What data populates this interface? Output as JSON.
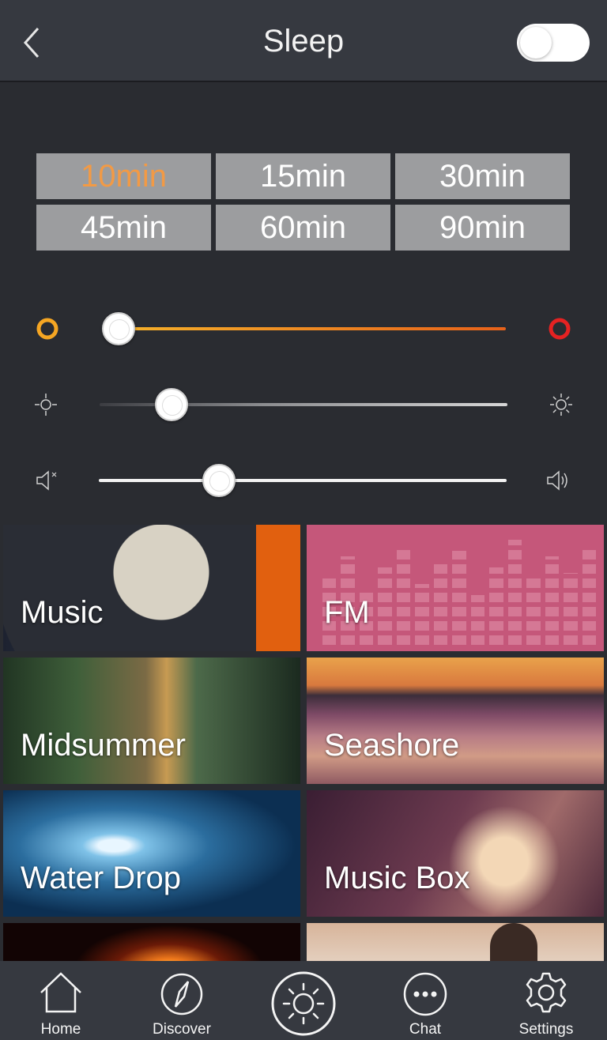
{
  "header": {
    "title": "Sleep",
    "toggle_on": false
  },
  "timer": {
    "options": [
      "10min",
      "15min",
      "30min",
      "45min",
      "60min",
      "90min"
    ],
    "selected": "10min",
    "selected_color": "#f29a45"
  },
  "sliders": {
    "color_temp": {
      "value_fraction": 0.04,
      "start_color": "#f5a623",
      "end_color": "#e52222"
    },
    "brightness": {
      "value_fraction": 0.18
    },
    "volume": {
      "value_fraction": 0.29
    }
  },
  "tiles": [
    {
      "label": "Music"
    },
    {
      "label": "FM"
    },
    {
      "label": "Midsummer"
    },
    {
      "label": "Seashore"
    },
    {
      "label": "Water Drop"
    },
    {
      "label": "Music Box"
    },
    {
      "label": ""
    },
    {
      "label": ""
    }
  ],
  "nav": {
    "items": [
      {
        "label": "Home",
        "icon": "home-icon"
      },
      {
        "label": "Discover",
        "icon": "compass-icon"
      },
      {
        "label": "",
        "icon": "sun-icon"
      },
      {
        "label": "Chat",
        "icon": "chat-icon"
      },
      {
        "label": "Settings",
        "icon": "gear-icon"
      }
    ]
  },
  "colors": {
    "background": "#2a2c31",
    "header": "#363940",
    "button": "#9c9d9f"
  }
}
